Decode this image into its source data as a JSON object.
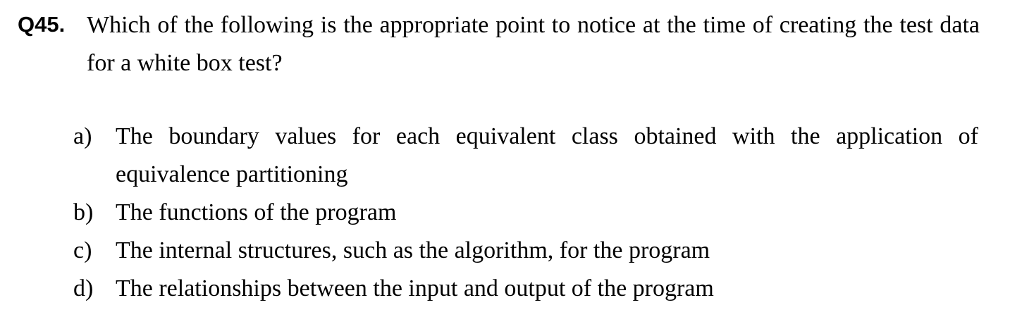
{
  "question": {
    "number": "Q45.",
    "text": "Which of the following is the appropriate point to notice at the time of creating the test data for a white box test?"
  },
  "options": [
    {
      "letter": "a)",
      "text": "The boundary values for each equivalent class obtained with the application of equivalence partitioning"
    },
    {
      "letter": "b)",
      "text": "The functions of the program"
    },
    {
      "letter": "c)",
      "text": "The internal structures, such as the algorithm, for the program"
    },
    {
      "letter": "d)",
      "text": "The relationships between the input and output of the program"
    }
  ]
}
